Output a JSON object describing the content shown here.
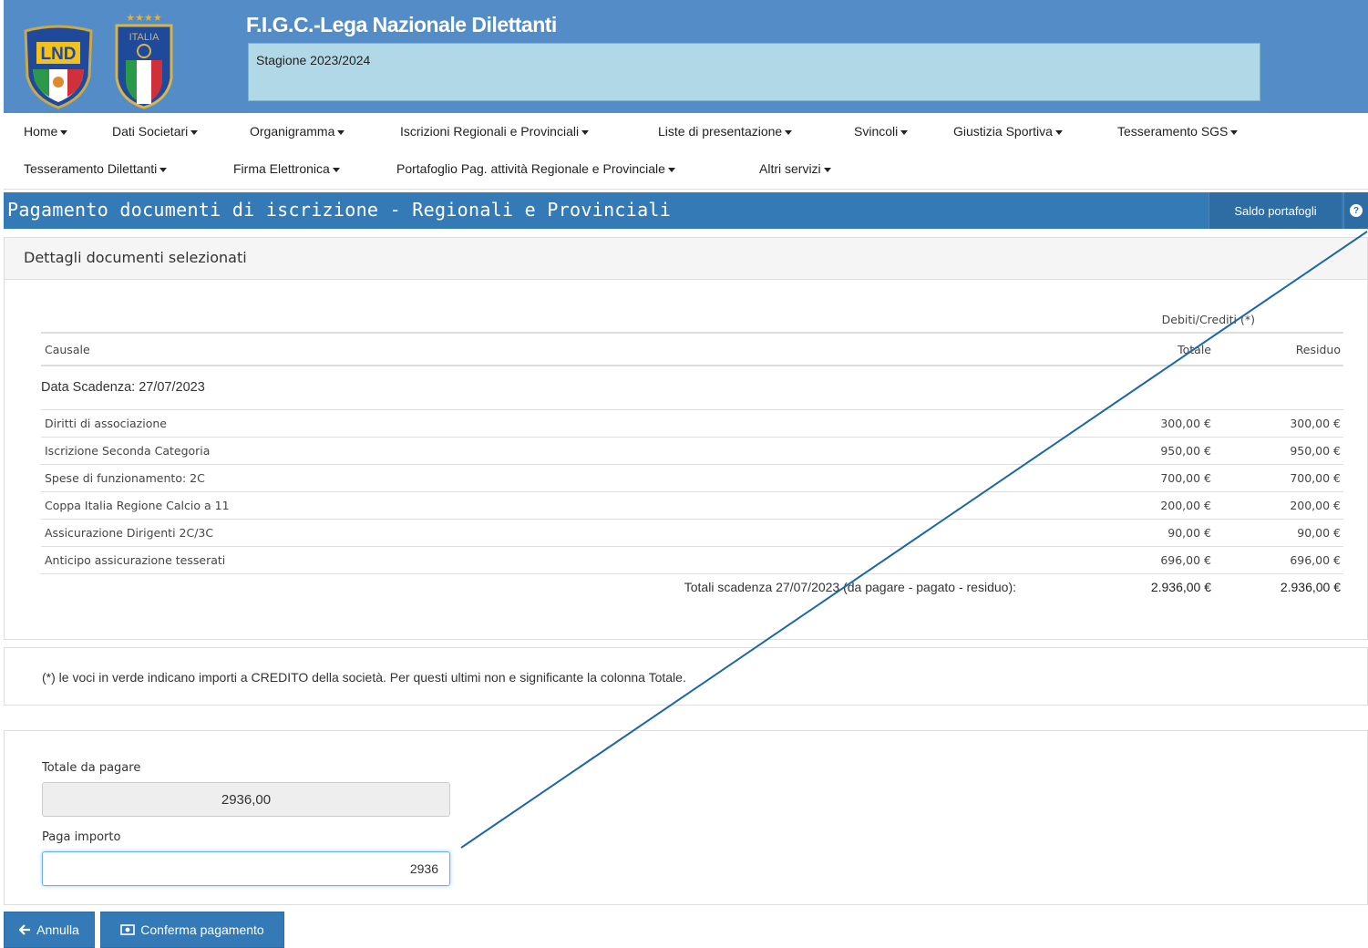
{
  "header": {
    "title": "F.I.G.C.-Lega Nazionale Dilettanti",
    "season": "Stagione 2023/2024",
    "logos": [
      {
        "name": "lnd-logo",
        "text": "LND"
      },
      {
        "name": "figc-italia-logo",
        "text": "ITALIA"
      }
    ]
  },
  "nav": {
    "items": [
      "Home",
      "Dati Societari",
      "Organigramma",
      "Iscrizioni Regionali e Provinciali",
      "Liste di presentazione",
      "Svincoli",
      "Giustizia Sportiva",
      "Tesseramento SGS",
      "Tesseramento Dilettanti",
      "Firma Elettronica",
      "Portafoglio Pag. attività Regionale e Provinciale",
      "Altri servizi"
    ]
  },
  "titlebar": {
    "title": "Pagamento documenti di iscrizione - Regionali e Provinciali",
    "saldo_label": "Saldo portafogli",
    "help_icon": "question-circle-icon"
  },
  "details": {
    "heading": "Dettagli documenti selezionati",
    "super_header": "Debiti/Crediti (*)",
    "columns": [
      "Causale",
      "Totale",
      "Residuo"
    ],
    "scadenza_label": "Data Scadenza: 27/07/2023",
    "rows": [
      {
        "causale": "Diritti di associazione",
        "totale": "300,00 €",
        "residuo": "300,00 €"
      },
      {
        "causale": "Iscrizione Seconda Categoria",
        "totale": "950,00 €",
        "residuo": "950,00 €"
      },
      {
        "causale": "Spese di funzionamento: 2C",
        "totale": "700,00 €",
        "residuo": "700,00 €"
      },
      {
        "causale": "Coppa Italia Regione Calcio a 11",
        "totale": "200,00 €",
        "residuo": "200,00 €"
      },
      {
        "causale": "Assicurazione Dirigenti 2C/3C",
        "totale": "90,00 €",
        "residuo": "90,00 €"
      },
      {
        "causale": "Anticipo assicurazione tesserati",
        "totale": "696,00 €",
        "residuo": "696,00 €"
      }
    ],
    "totals_label": "Totali scadenza 27/07/2023 (da pagare - pagato - residuo):",
    "totals_totale": "2.936,00 €",
    "totals_residuo": "2.936,00 €"
  },
  "note": "(*) le voci in verde indicano importi a CREDITO della società. Per questi ultimi non e significante la colonna Totale.",
  "payment": {
    "totale_label": "Totale da pagare",
    "totale_value": "2936,00",
    "paga_label": "Paga importo",
    "paga_value": "2936"
  },
  "buttons": {
    "annulla": "Annulla",
    "annulla_icon": "arrow-left-icon",
    "conferma": "Conferma pagamento",
    "conferma_icon": "money-icon"
  },
  "colors": {
    "header_bg": "#548cc8",
    "season_box": "#b0d8e7",
    "primary": "#337ab7",
    "annotation_line": "#1b67a8"
  }
}
